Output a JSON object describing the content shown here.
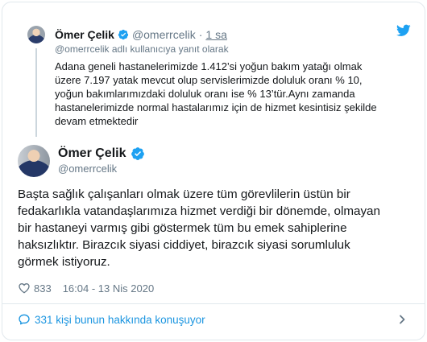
{
  "colors": {
    "accent": "#1da1f2",
    "link": "#1b95e0",
    "muted": "#657786",
    "text": "#14171a",
    "border": "#e1e8ed"
  },
  "icons": {
    "brand": "twitter-bird-icon",
    "verified": "verified-badge-icon",
    "like": "heart-icon",
    "conversation": "speech-bubble-icon",
    "more": "chevron-right-icon"
  },
  "reply_tweet": {
    "name": "Ömer Çelik",
    "handle": "@omerrcelik",
    "separator": "·",
    "time": "1 sa",
    "reply_to": "@omerrcelik adlı kullanıcıya yanıt olarak",
    "text": "Adana geneli hastanelerimizde 1.412’si yoğun bakım yatağı olmak\nüzere 7.197 yatak mevcut olup servislerimizde doluluk oranı % 10,\nyoğun bakımlarımızdaki doluluk oranı ise % 13’tür.Aynı zamanda\nhastanelerimizde normal hastalarımız için de hizmet kesintisiz şekilde\ndevam etmektedir"
  },
  "main_tweet": {
    "name": "Ömer Çelik",
    "handle": "@omerrcelik",
    "text": "Başta sağlık çalışanları olmak üzere tüm görevlilerin üstün bir\nfedakarlıkla vatandaşlarımıza hizmet verdiği bir dönemde, olmayan\nbir hastaneyi varmış gibi göstermek tüm bu emek sahiplerine\nhaksızlıktır. Birazcık siyasi ciddiyet, birazcık siyasi sorumluluk\ngörmek istiyoruz.",
    "likes": "833",
    "timestamp": "16:04 - 13 Nis 2020"
  },
  "footer": {
    "conversation_label": "331 kişi bunun hakkında konuşuyor"
  }
}
